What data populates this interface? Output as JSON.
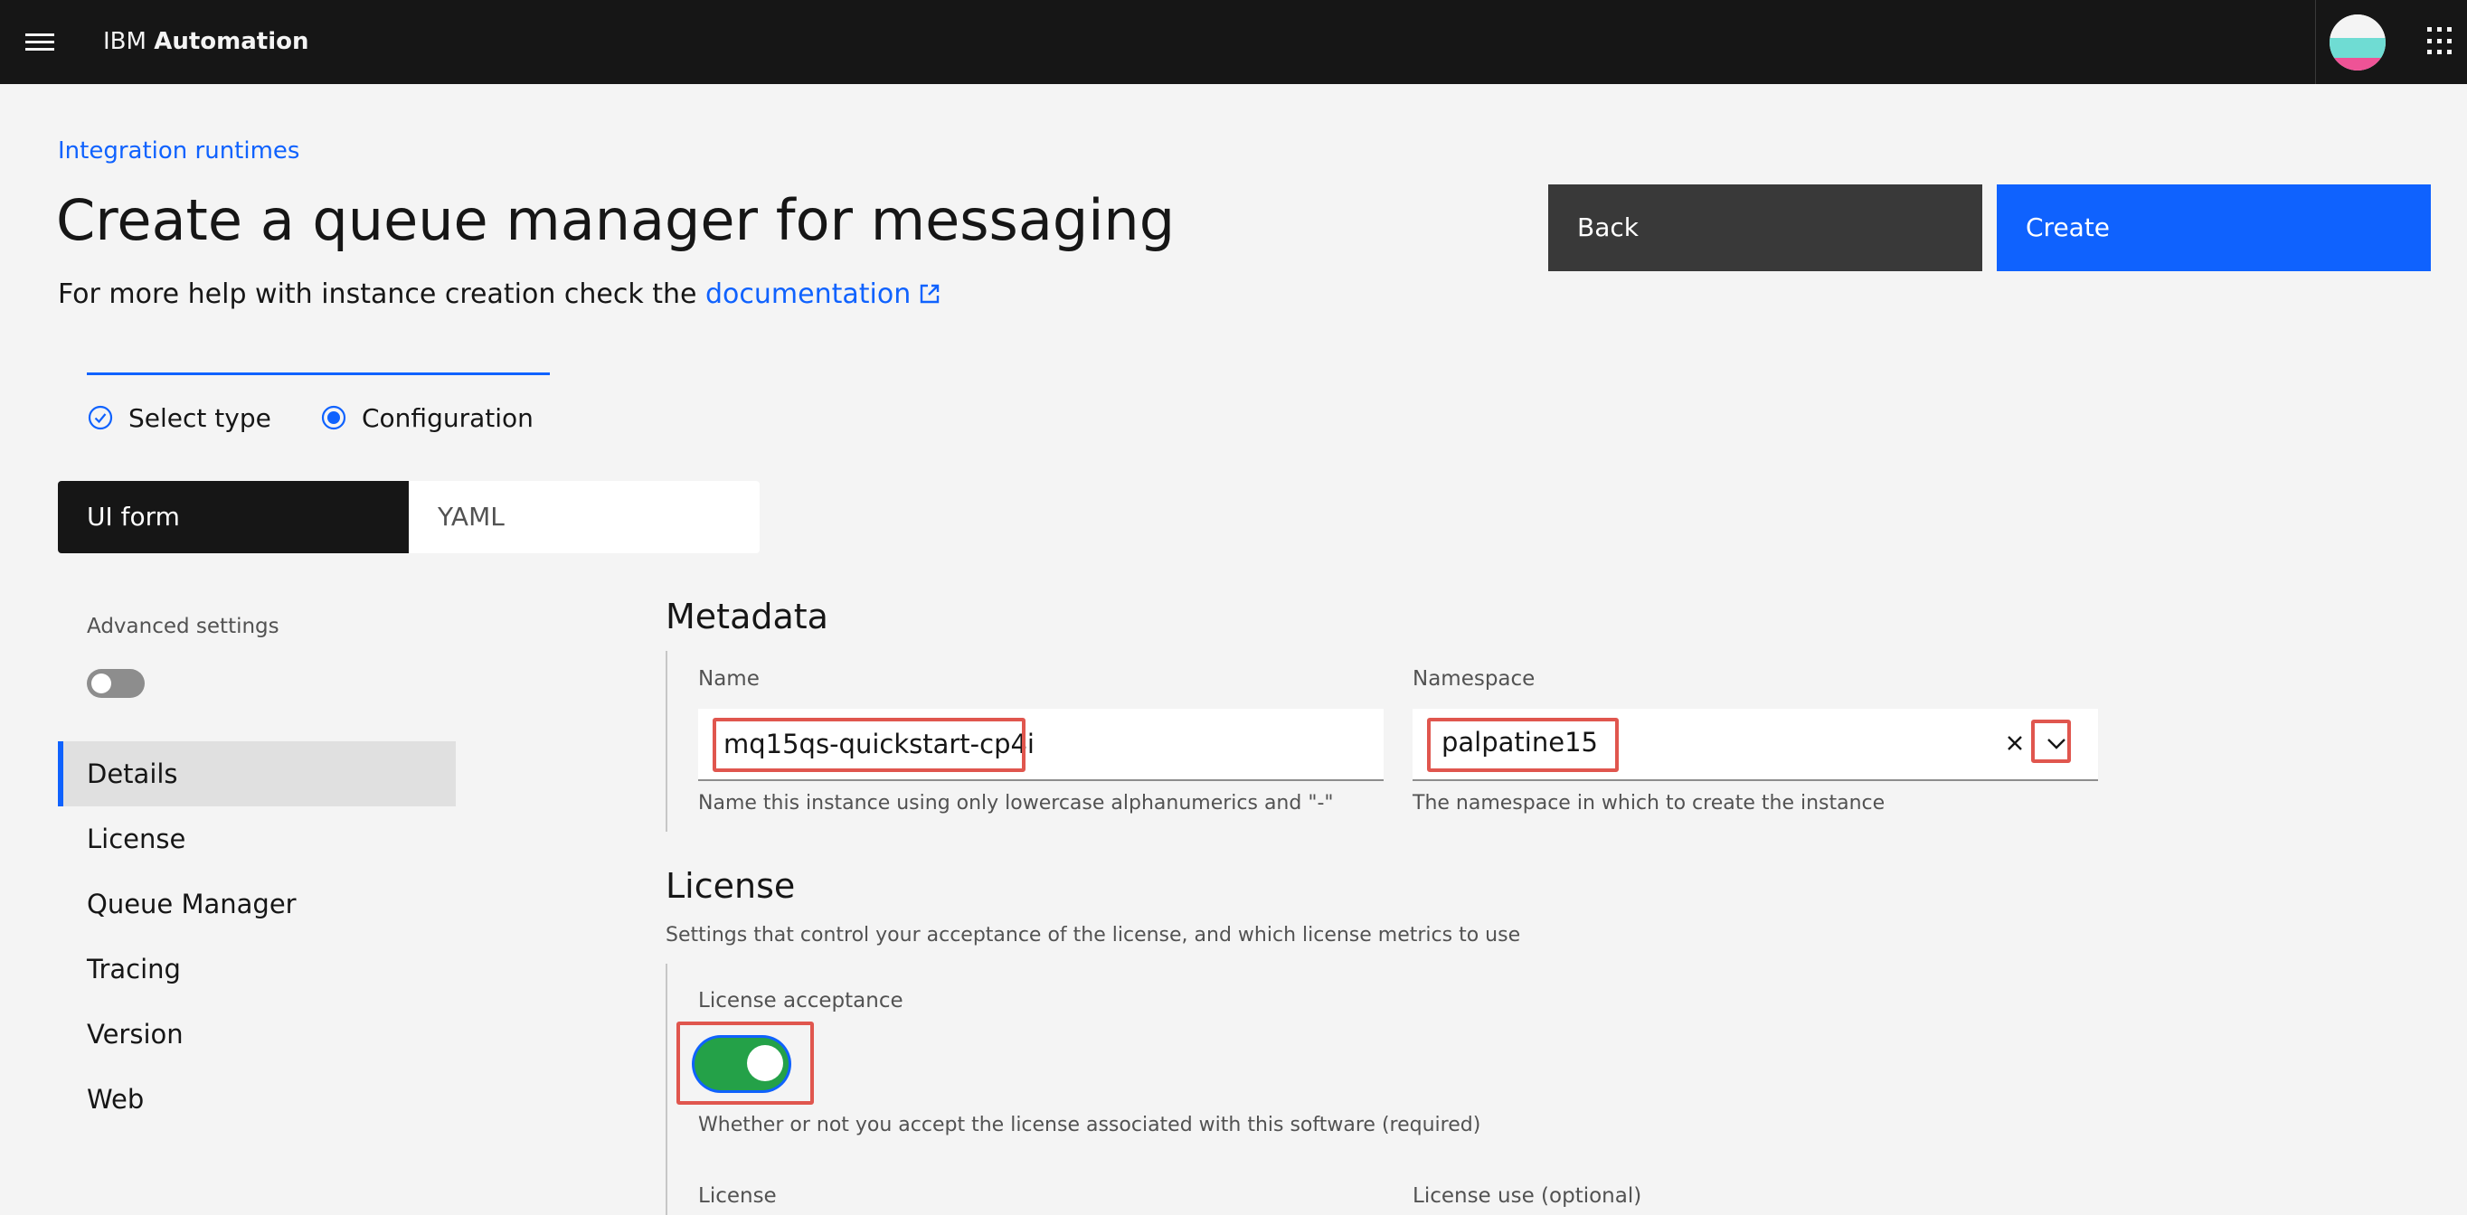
{
  "header": {
    "brand_prefix": "IBM",
    "brand_name": "Automation"
  },
  "breadcrumb": "Integration runtimes",
  "page": {
    "title": "Create a queue manager for messaging",
    "help_text": "For more help with instance creation check the ",
    "help_link": "documentation"
  },
  "actions": {
    "back_label": "Back",
    "create_label": "Create"
  },
  "progress": {
    "steps": [
      {
        "label": "Select type",
        "state": "complete"
      },
      {
        "label": "Configuration",
        "state": "current"
      }
    ]
  },
  "view_switcher": {
    "options": [
      "UI form",
      "YAML"
    ],
    "selected": "UI form"
  },
  "sidebar": {
    "advanced_label": "Advanced settings",
    "advanced_enabled": false,
    "items": [
      {
        "label": "Details",
        "active": true
      },
      {
        "label": "License"
      },
      {
        "label": "Queue Manager"
      },
      {
        "label": "Tracing"
      },
      {
        "label": "Version"
      },
      {
        "label": "Web"
      }
    ]
  },
  "metadata": {
    "title": "Metadata",
    "name_label": "Name",
    "name_value": "mq15qs-quickstart-cp4i",
    "name_helper": "Name this instance using only lowercase alphanumerics and \"-\"",
    "namespace_label": "Namespace",
    "namespace_value": "palpatine15",
    "namespace_helper": "The namespace in which to create the instance"
  },
  "license": {
    "title": "License",
    "description": "Settings that control your acceptance of the license, and which license metrics to use",
    "acceptance_label": "License acceptance",
    "acceptance_enabled": true,
    "acceptance_helper": "Whether or not you accept the license associated with this software (required)",
    "license_label": "License",
    "license_use_label": "License use (optional)"
  },
  "colors": {
    "accent": "#0f62fe",
    "header_bg": "#161616",
    "toggle_on": "#24a148",
    "highlight": "#e0564e"
  },
  "icons": [
    "menu-icon",
    "app-switcher-icon",
    "external-link-icon",
    "checkmark-outline-icon",
    "radio-button-checked-icon",
    "close-icon",
    "chevron-down-icon"
  ]
}
